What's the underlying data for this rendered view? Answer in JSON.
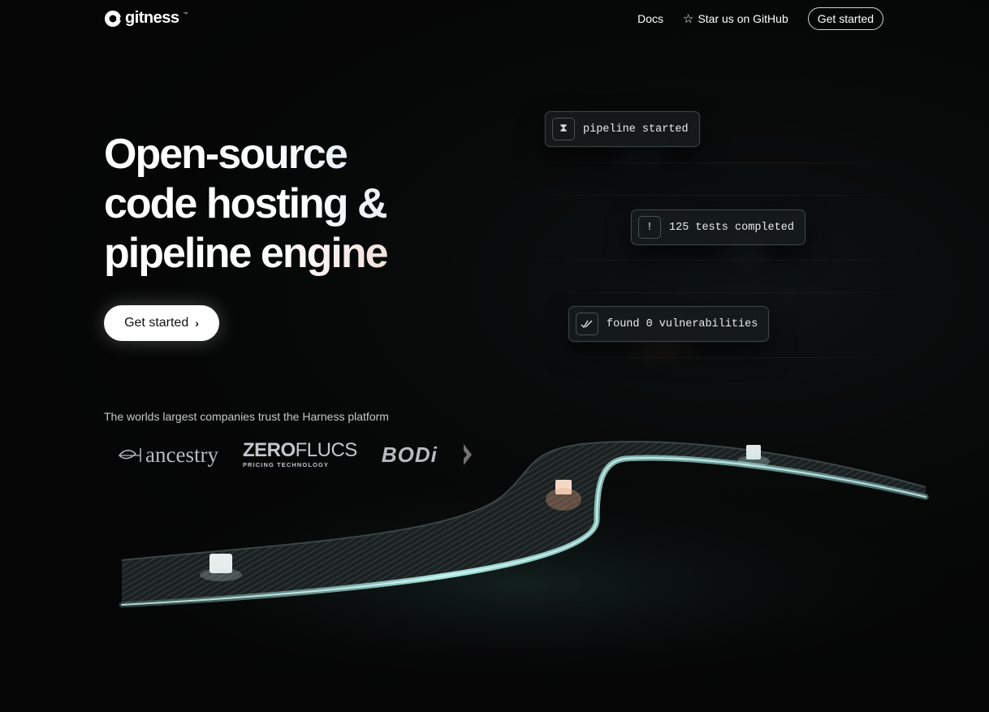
{
  "brand": {
    "name": "gitness",
    "tm": "™"
  },
  "nav": {
    "docs": "Docs",
    "github": "Star us on GitHub",
    "cta": "Get started"
  },
  "hero": {
    "line1": "Open-source",
    "line2": "code hosting &",
    "line3": "pipeline engine",
    "cta": "Get started"
  },
  "trust": {
    "text": "The worlds largest companies trust the Harness platform",
    "logos": {
      "ancestry": "ancestry",
      "zero_a": "ZERO",
      "zero_b": "FLUCS",
      "zero_sub": "PRICING TECHNOLOGY",
      "bodi": "BODi"
    }
  },
  "status": [
    {
      "text": "pipeline started",
      "icon": "hourglass-icon"
    },
    {
      "text": "125 tests completed",
      "icon": "exclamation-icon"
    },
    {
      "text": "found 0 vulnerabilities",
      "icon": "double-check-icon"
    }
  ],
  "colors": {
    "background": "#060707",
    "text": "#ffffff",
    "pill_bg": "#161a1b",
    "pill_border": "#3d4444",
    "belt_glow": "#8fd3cf"
  }
}
